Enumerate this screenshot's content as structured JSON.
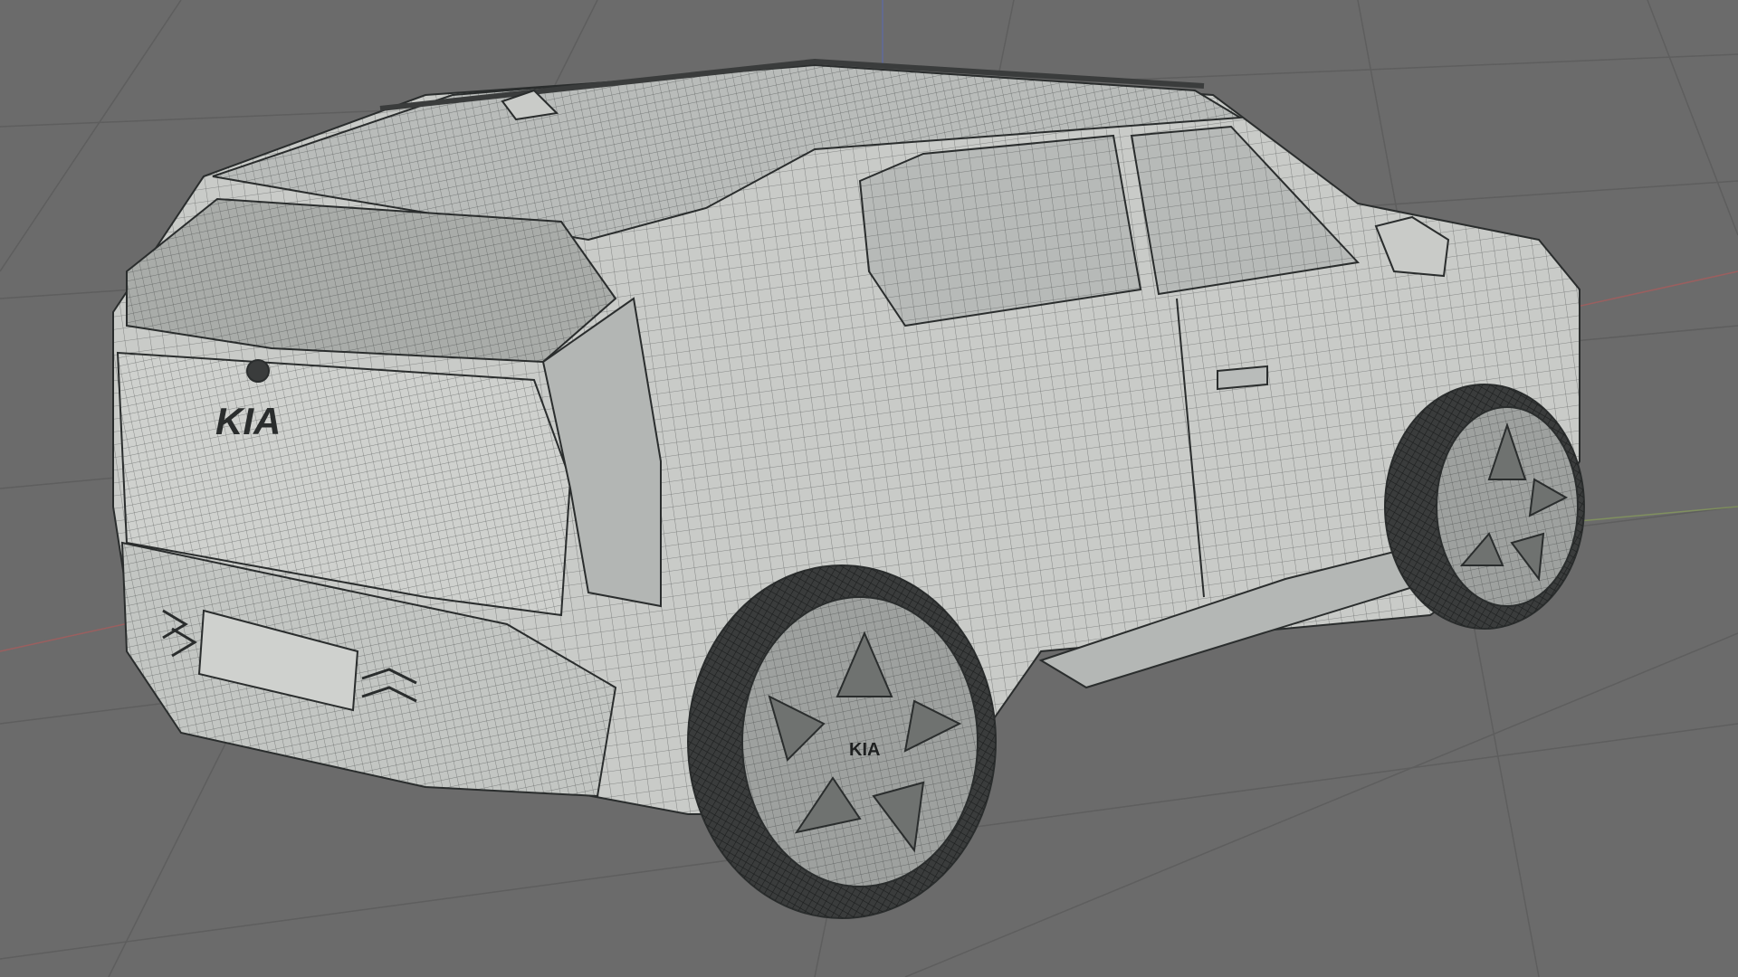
{
  "viewport": {
    "background": "#6b6b6b",
    "grid_color": "#5e5e5e",
    "axis_x_color": "#b05a5a",
    "axis_y_color": "#8aa05a",
    "axis_z_color": "#5a6ab0"
  },
  "model": {
    "body_color": "#c9cbc8",
    "shade_color": "#a9aca9",
    "glass_color": "#b7bab8",
    "wire_color": "#2a2d2d",
    "tire_color": "#3a3c3c",
    "rim_color": "#9ea19f",
    "badge_text": "KIA",
    "wheel_badge_text": "KIA"
  }
}
